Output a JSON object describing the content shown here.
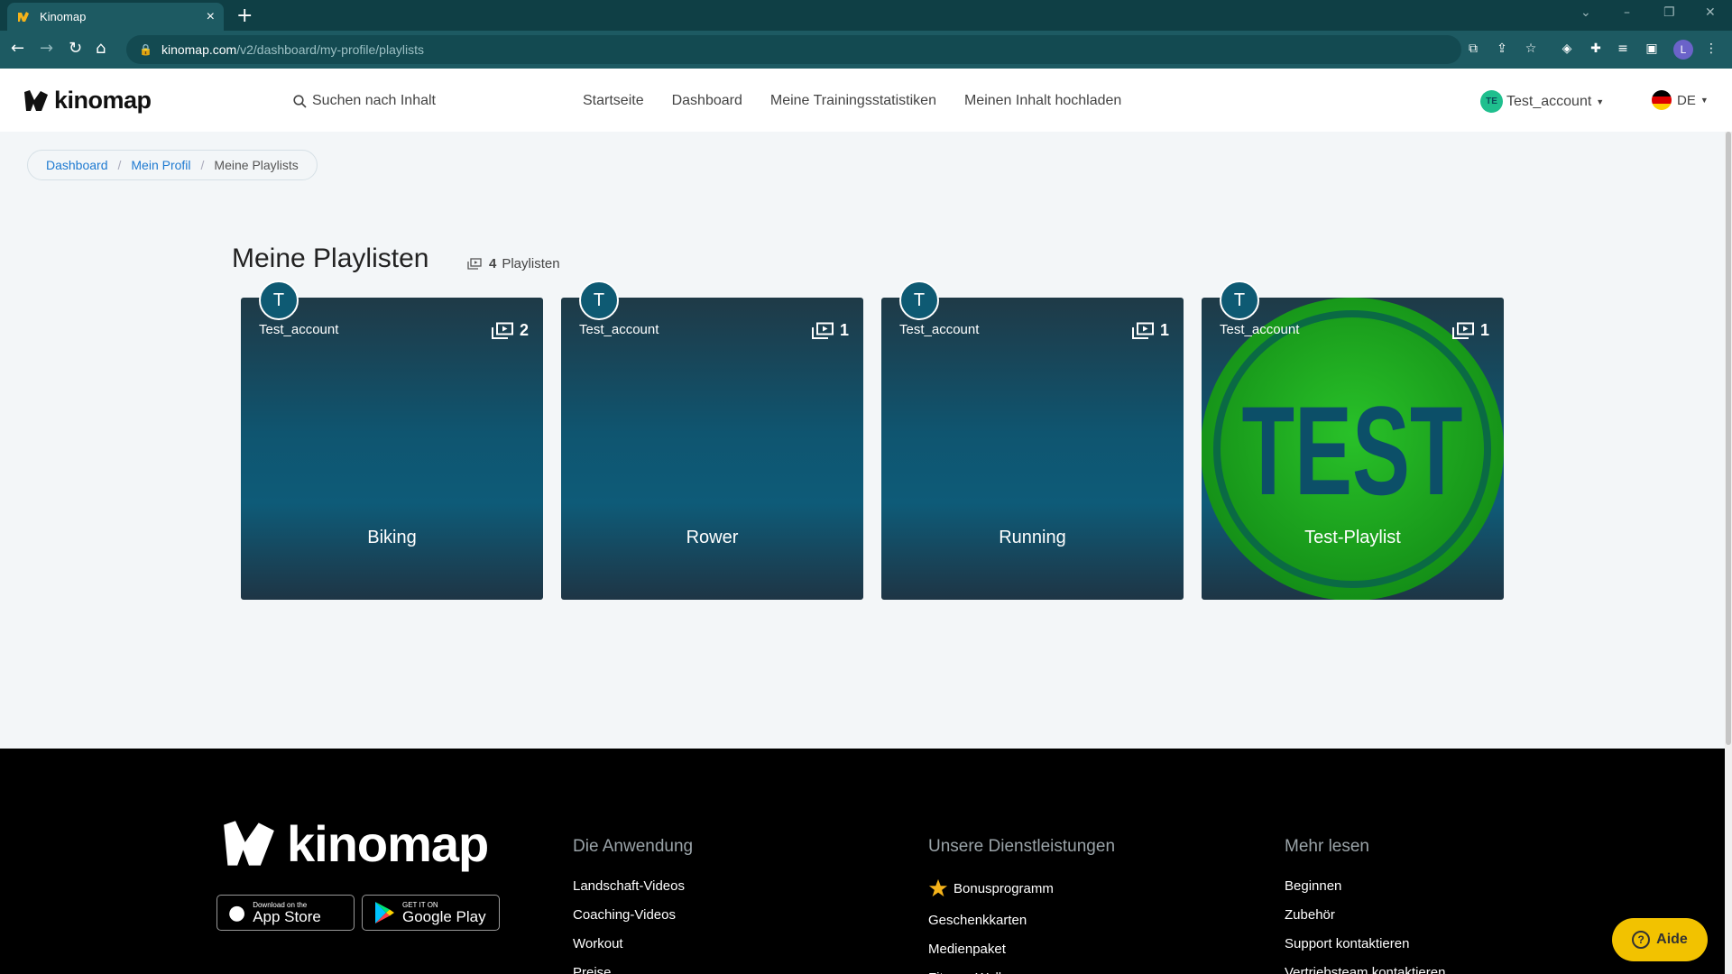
{
  "browser": {
    "tab_title": "Kinomap",
    "url_host": "kinomap.com",
    "url_path": "/v2/dashboard/my-profile/playlists",
    "profile_initial": "L"
  },
  "header": {
    "logo_text": "kinomap",
    "search_placeholder": "Suchen nach Inhalt",
    "nav": [
      "Startseite",
      "Dashboard",
      "Meine Trainingsstatistiken",
      "Meinen Inhalt hochladen"
    ],
    "user_initials": "TE",
    "user_name": "Test_account",
    "lang": "DE"
  },
  "breadcrumb": {
    "items": [
      "Dashboard",
      "Mein Profil",
      "Meine Playlists"
    ]
  },
  "page": {
    "title": "Meine Playlisten",
    "count": "4",
    "count_label": "Playlisten"
  },
  "playlists": [
    {
      "initial": "T",
      "owner": "Test_account",
      "items": "2",
      "name": "Biking"
    },
    {
      "initial": "T",
      "owner": "Test_account",
      "items": "1",
      "name": "Rower"
    },
    {
      "initial": "T",
      "owner": "Test_account",
      "items": "1",
      "name": "Running"
    },
    {
      "initial": "T",
      "owner": "Test_account",
      "items": "1",
      "name": "Test-Playlist",
      "cover_text": "TEST"
    }
  ],
  "footer": {
    "logo_text": "kinomap",
    "app_store_small": "Download on the",
    "app_store_big": "App Store",
    "google_small": "GET IT ON",
    "google_big": "Google Play",
    "columns": [
      {
        "head": "Die Anwendung",
        "links": [
          "Landschaft-Videos",
          "Coaching-Videos",
          "Workout",
          "Preise"
        ]
      },
      {
        "head": "Unsere Dienstleistungen",
        "links": [
          "Bonusprogramm",
          "Geschenkkarten",
          "Medienpaket",
          "Fitness Walls"
        ]
      },
      {
        "head": "Mehr lesen",
        "links": [
          "Beginnen",
          "Zubehör",
          "Support kontaktieren",
          "Vertriebsteam kontaktieren"
        ]
      }
    ]
  },
  "help_label": "Aide",
  "colors": {
    "browser_dark": "#0f3f45",
    "browser_tab": "#1d5a62",
    "card_blue": "#0e5a73",
    "link_blue": "#1e7ad1",
    "help_yellow": "#f2c200",
    "test_green": "#1ba51e"
  }
}
